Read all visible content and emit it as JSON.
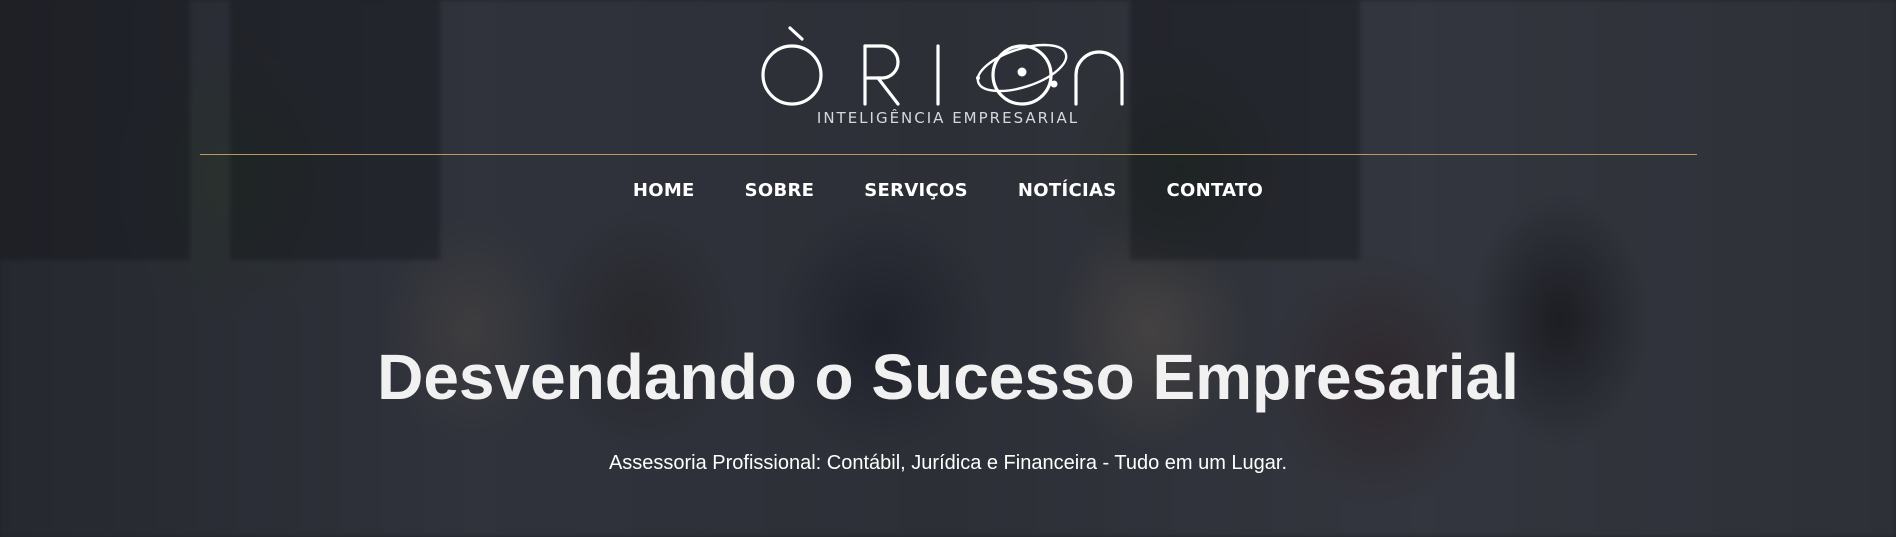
{
  "brand": {
    "name": "ÓRION",
    "tagline": "INTELIGÊNCIA EMPRESARIAL",
    "accent_color": "#b89a5e"
  },
  "nav": {
    "items": [
      {
        "label": "HOME"
      },
      {
        "label": "SOBRE"
      },
      {
        "label": "SERVIÇOS"
      },
      {
        "label": "NOTÍCIAS"
      },
      {
        "label": "CONTATO"
      }
    ]
  },
  "hero": {
    "title": "Desvendando o Sucesso Empresarial",
    "subtitle": "Assessoria Profissional: Contábil, Jurídica e Financeira - Tudo em um Lugar."
  }
}
